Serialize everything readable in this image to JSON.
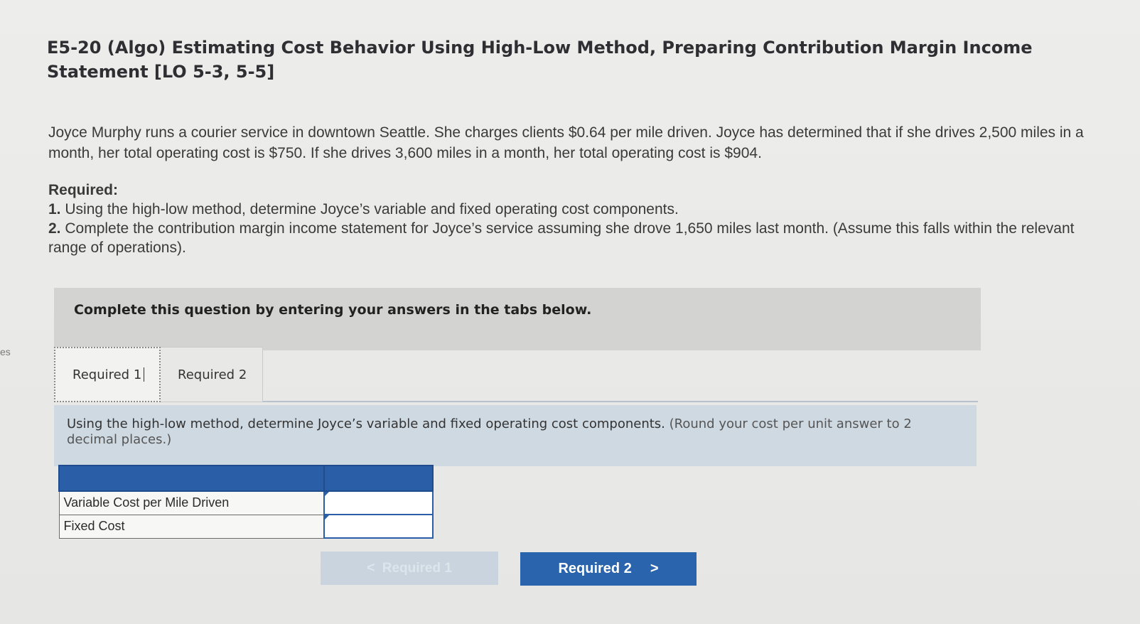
{
  "edge_text": "es",
  "title": "E5-20 (Algo) Estimating Cost Behavior Using High-Low Method, Preparing Contribution Margin Income Statement [LO 5-3, 5-5]",
  "intro": "Joyce Murphy runs a courier service in downtown Seattle. She charges clients $0.64 per mile driven. Joyce has determined that if she drives 2,500 miles in a month, her total operating cost is $750. If she drives 3,600 miles in a month, her total operating cost is $904.",
  "required": {
    "heading": "Required:",
    "items": [
      {
        "num": "1.",
        "text": "Using the high-low method, determine Joyce’s variable and fixed operating cost components."
      },
      {
        "num": "2.",
        "text": "Complete the contribution margin income statement for Joyce’s service assuming she drove 1,650 miles last month. (Assume this falls within the relevant range of operations)."
      }
    ]
  },
  "instruction": "Complete this question by entering your answers in the tabs below.",
  "tabs": [
    {
      "label": "Required 1",
      "active": true
    },
    {
      "label": "Required 2",
      "active": false
    }
  ],
  "question": {
    "text": "Using the high-low method, determine Joyce’s variable and fixed operating cost components.",
    "note": "(Round your cost per unit answer to 2 decimal places.)"
  },
  "table": {
    "rows": [
      {
        "label": "Variable Cost per Mile Driven",
        "value": ""
      },
      {
        "label": "Fixed Cost",
        "value": ""
      }
    ]
  },
  "nav": {
    "prev_label": "Required 1",
    "next_label": "Required 2",
    "prev_icon": "chevron-left-icon",
    "next_icon": "chevron-right-icon"
  },
  "colors": {
    "accent": "#2a64ad",
    "header_fill": "#2a5fa8",
    "question_bg": "#cfd9e2",
    "instruction_bg": "#d3d3d1"
  }
}
